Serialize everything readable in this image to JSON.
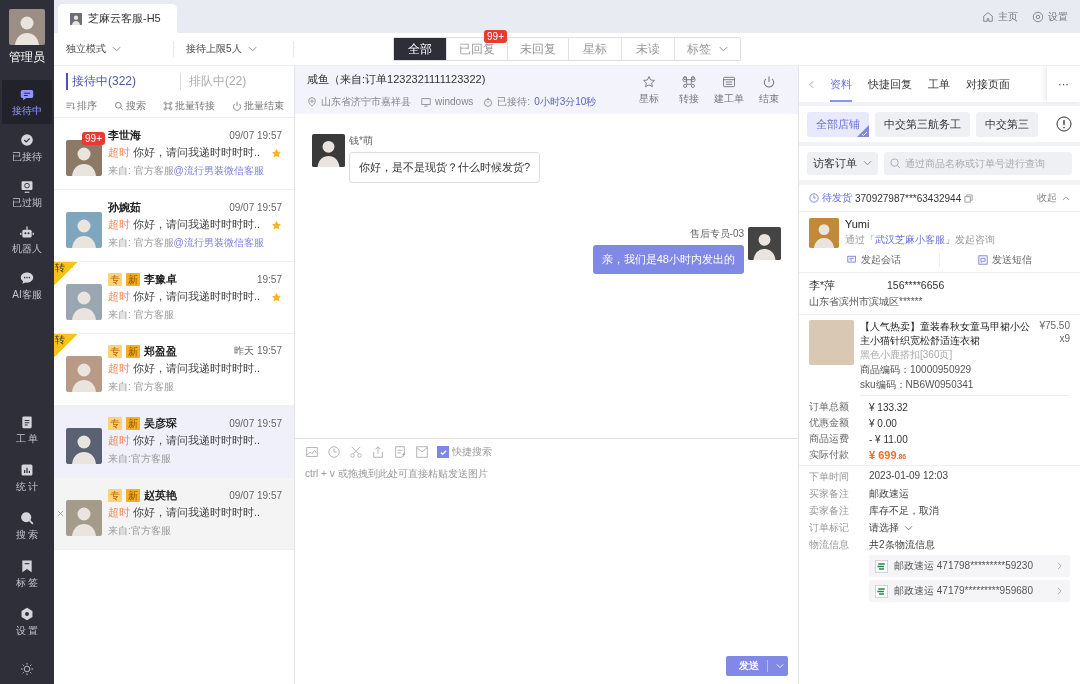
{
  "nav": {
    "user_label": "管理员",
    "top_items": [
      {
        "label": "接待中",
        "selected": true
      },
      {
        "label": "已接待",
        "selected": false
      },
      {
        "label": "已过期",
        "selected": false
      },
      {
        "label": "机器人",
        "selected": false
      },
      {
        "label": "AI客服",
        "selected": false
      }
    ],
    "bottom_items": [
      {
        "label": "工 单",
        "selected": false
      },
      {
        "label": "统 计",
        "selected": false
      },
      {
        "label": "搜 索",
        "selected": false
      },
      {
        "label": "标 签",
        "selected": false
      },
      {
        "label": "设 置",
        "selected": false
      }
    ]
  },
  "app_tab": {
    "title": "芝麻云客服-H5"
  },
  "top_links": [
    "主页",
    "设置"
  ],
  "mode_selects": [
    "独立模式",
    "接待上限5人"
  ],
  "filters": [
    {
      "label": "全部",
      "selected": true,
      "kind": "plain"
    },
    {
      "label": "已回复",
      "selected": false,
      "kind": "plain",
      "badge": "99+"
    },
    {
      "label": "未回复",
      "selected": false,
      "kind": "plain"
    },
    {
      "label": "星标",
      "selected": false,
      "kind": "plain"
    },
    {
      "label": "未读",
      "selected": false,
      "kind": "plain"
    },
    {
      "label": "标签",
      "selected": false,
      "kind": "dropdown"
    }
  ],
  "queue_tabs": [
    {
      "label": "接待中(322)",
      "selected": true
    },
    {
      "label": "排队中(22)",
      "selected": false
    }
  ],
  "list_actions": [
    "排序",
    "搜索",
    "批量转接",
    "批量结束"
  ],
  "conversations": [
    {
      "name": "李世海",
      "time": "09/07 19:57",
      "badge": "99+",
      "status": "超时",
      "preview": "你好，请问我递时时时时..",
      "source": "来自: 官方客服",
      "source_link": "@流行男装微信客服",
      "starred": true,
      "selected": false,
      "hovered": false
    },
    {
      "name": "孙婉茹",
      "time": "09/07 19:57",
      "status": "超时",
      "preview": "你好，请问我递时时时时..",
      "source": "来自: 官方客服",
      "source_link": "@流行男装微信客服",
      "starred": true,
      "selected": false,
      "hovered": false
    },
    {
      "name": "李豫卓",
      "time": "19:57",
      "ribbon": "转",
      "tags": [
        "专",
        "新"
      ],
      "status": "超时",
      "preview": "你好，请问我递时时时时..",
      "source": "来自: 官方客服",
      "starred": true,
      "selected": false,
      "hovered": false
    },
    {
      "name": "郑盈盈",
      "time": "昨天 19:57",
      "ribbon": "转",
      "tags": [
        "专",
        "新"
      ],
      "status": "超时",
      "preview": "你好，请问我递时时时时..",
      "source": "来自: 官方客服",
      "starred": false,
      "selected": false,
      "hovered": false
    },
    {
      "name": "吴彦琛",
      "time": "09/07 19:57",
      "tags": [
        "专",
        "新"
      ],
      "status": "超时",
      "preview": "你好，请问我递时时时时..",
      "source": "来自:官方客服",
      "starred": false,
      "selected": true,
      "hovered": false
    },
    {
      "name": "赵英艳",
      "time": "09/07 19:57",
      "tags": [
        "专",
        "新"
      ],
      "status": "超时",
      "preview": "你好，请问我递时时时时..",
      "source": "来自:官方客服",
      "starred": false,
      "selected": false,
      "hovered": true
    }
  ],
  "chat": {
    "title": "咸鱼（来自:订单1232321111123322)",
    "location": "山东省济宁市嘉祥县",
    "device": "windows",
    "wait_label": "已接待:",
    "wait_value": "0小时3分10秒",
    "actions": [
      "星标",
      "转接",
      "建工单",
      "结束"
    ],
    "messages": [
      {
        "kind": "incoming",
        "sender": "钱*萌",
        "text": "你好，是不是现货？什么时候发货?"
      },
      {
        "kind": "outgoing",
        "sender": "售后专员-03",
        "text": "亲，我们是48小时内发出的"
      }
    ],
    "quick_search": {
      "label": "快捷搜索",
      "checked": true
    },
    "placeholder": "ctrl + v 或拖拽到此处可直接粘贴发送图片",
    "send": "发送"
  },
  "panel": {
    "tabs": [
      {
        "label": "资料",
        "selected": true
      },
      {
        "label": "快捷回复",
        "selected": false
      },
      {
        "label": "工单",
        "selected": false
      },
      {
        "label": "对接页面",
        "selected": false
      }
    ],
    "more": "···",
    "stores": [
      {
        "label": "全部店铺",
        "selected": true
      },
      {
        "label": "中交第三航务工",
        "selected": false
      },
      {
        "label": "中交第三",
        "selected": false
      }
    ],
    "order_select": "访客订单",
    "search_placeholder": "通过商品名称或订单号进行查询",
    "order": {
      "status": "待发货",
      "number": "370927987***63432944",
      "collapse": "收起",
      "customer": "Yumi",
      "via_prefix": "通过",
      "via_link": "「武汉芝麻小客服」",
      "via_suffix": "发起咨询",
      "actions": [
        "发起会话",
        "发送短信"
      ],
      "receiver": "李*萍",
      "phone": "156****6656",
      "address": "山东省滨州市滨城区******",
      "product": {
        "title": "【人气热卖】童装春秋女童马甲裙小公主小猫针织宽松舒适连衣裙",
        "price": "¥75.50",
        "qty": "x9",
        "variant": "黑色小鹿搭扣[360页]",
        "code": "商品编码：10000950929",
        "sku": "sku编码：NB6W0950341"
      },
      "totals": [
        {
          "label": "订单总额",
          "value": "¥ 133.32",
          "kind": "amount"
        },
        {
          "label": "优惠金额",
          "value": "¥ 0.00",
          "kind": "amount"
        },
        {
          "label": "商品运费",
          "value": "- ¥ 11.00",
          "kind": "amount"
        },
        {
          "label": "实际付款",
          "value": "¥ 699",
          "fraction": ".86",
          "kind": "paid"
        }
      ],
      "details": [
        {
          "label": "下单时间",
          "value": "2023-01-09 12:03",
          "kind": "text"
        },
        {
          "label": "买家备注",
          "value": "邮政速运",
          "kind": "text"
        },
        {
          "label": "卖家备注",
          "value": "库存不足，取消",
          "kind": "text"
        },
        {
          "label": "订单标记",
          "value": "请选择",
          "kind": "select"
        },
        {
          "label": "物流信息",
          "value": "共2条物流信息",
          "kind": "logistics",
          "entries": [
            "邮政速运 471798*********59230",
            "邮政速运 47179*********959680"
          ]
        }
      ]
    }
  }
}
